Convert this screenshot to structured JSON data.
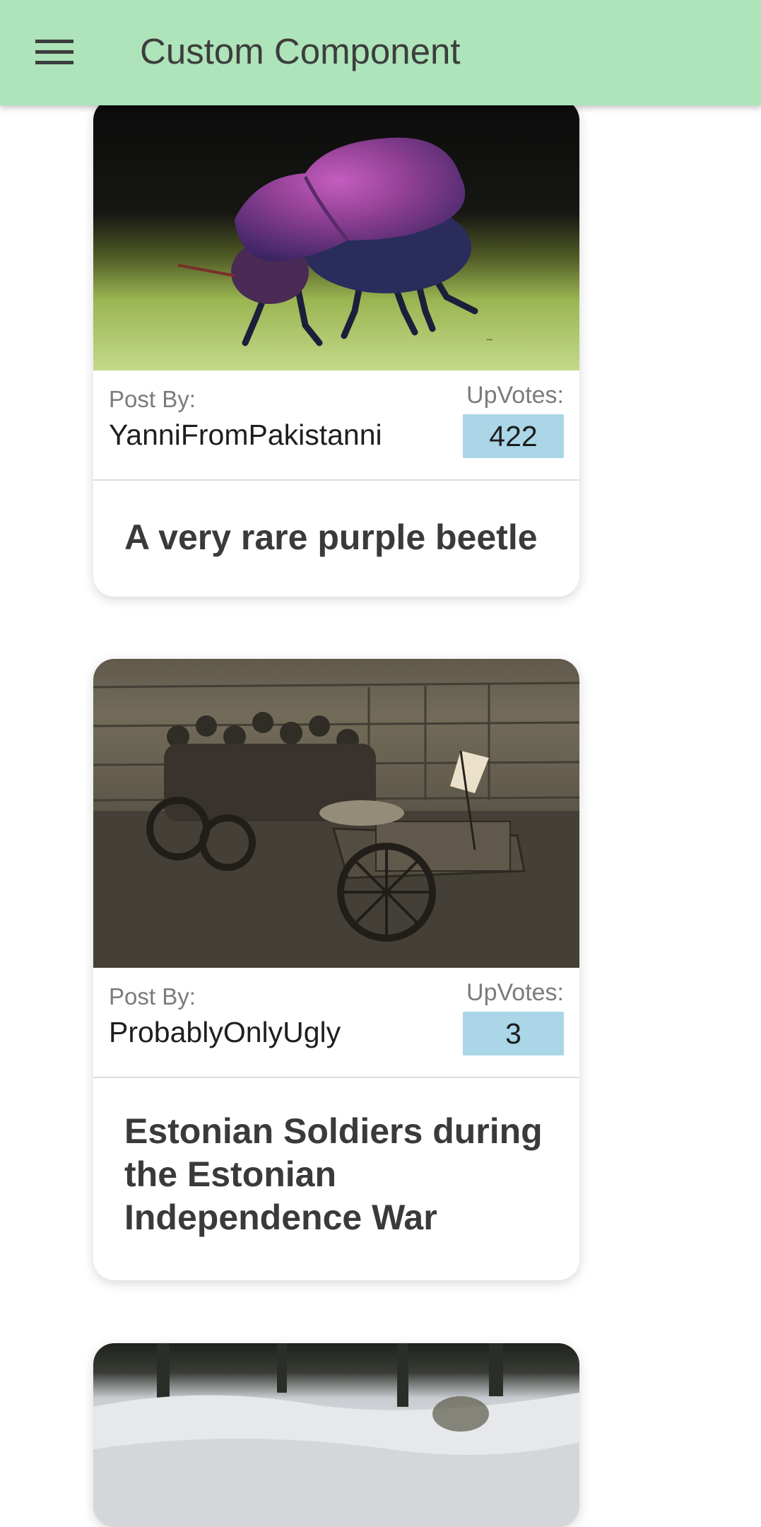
{
  "app_bar": {
    "title": "Custom Component",
    "menu_icon": "menu-icon",
    "background_color": "#ade4b9"
  },
  "posts": [
    {
      "image": "photo of a purple beetle on green grass",
      "post_by_label": "Post By:",
      "author": "YanniFromPakistanni",
      "upvotes_label": "UpVotes:",
      "upvotes": "422",
      "title": "A very rare purple beetle"
    },
    {
      "image": "sepia photo of soldiers on a vintage armored vehicle",
      "post_by_label": "Post By:",
      "author": "ProbablyOnlyUgly",
      "upvotes_label": "UpVotes:",
      "upvotes": "3",
      "title": "Estonian Soldiers during the Estonian Independence War"
    },
    {
      "image": "photo of a snowy landscape"
    }
  ],
  "colors": {
    "upvote_badge": "#aad6e7",
    "card_background": "#ffffff"
  }
}
